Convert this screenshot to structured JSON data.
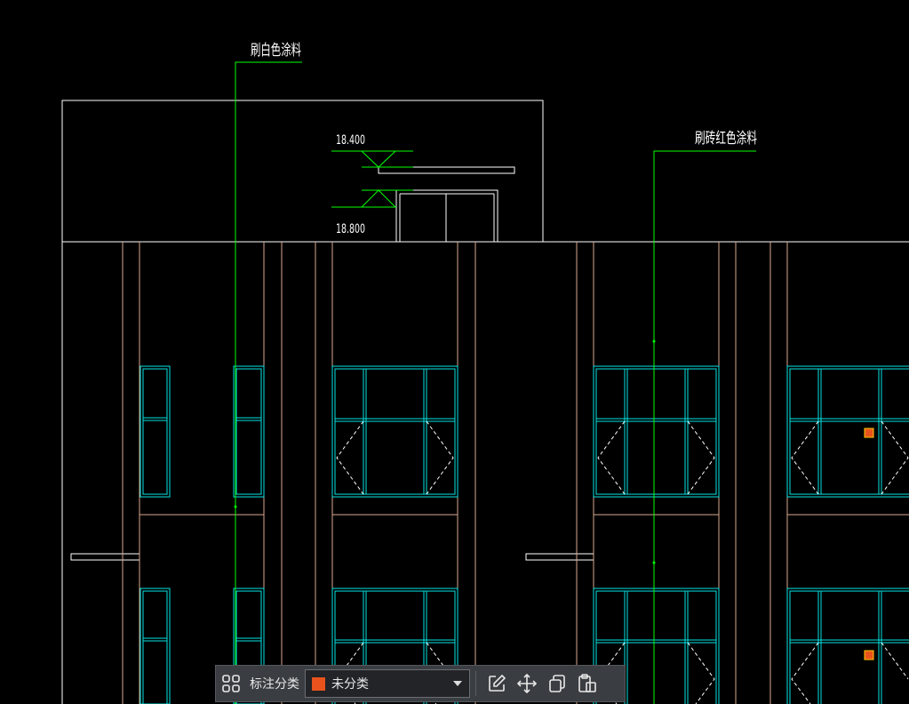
{
  "drawing": {
    "annotation_white_paint": "刷白色涂料",
    "annotation_brick_red_paint": "刷砖红色涂料",
    "elevation_top": "18.400",
    "elevation_bottom": "18.800"
  },
  "toolbar": {
    "category_label": "标注分类",
    "category_value": "未分类",
    "category_color": "#e8531d",
    "icons": [
      "grid-apps-icon",
      "edit-icon",
      "move-icon",
      "copy-icon",
      "paste-icon"
    ]
  },
  "colors": {
    "background": "#000000",
    "outline": "#ffffff",
    "window": "#00e5e5",
    "leader": "#00ff00",
    "column": "#d9a88f",
    "toolbar_bg": "#3a3d41"
  }
}
